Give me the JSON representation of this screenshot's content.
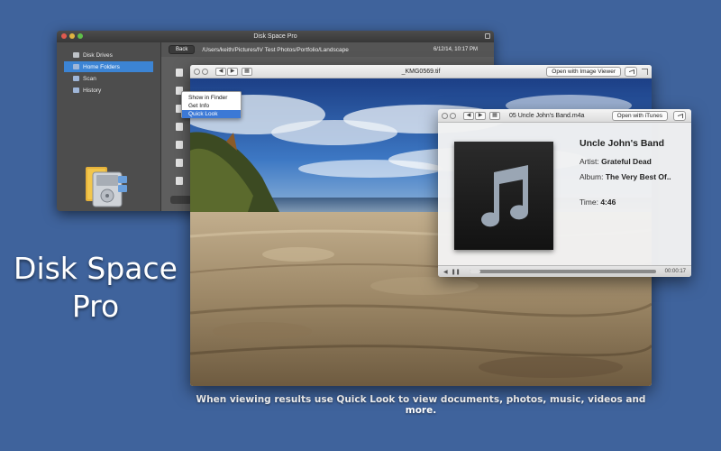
{
  "main_window": {
    "title": "Disk Space Pro",
    "sidebar": {
      "items": [
        {
          "label": "Disk Drives",
          "icon": "disk-icon",
          "active": false
        },
        {
          "label": "Home Folders",
          "icon": "folder-icon",
          "active": true
        },
        {
          "label": "Scan",
          "icon": "folder-icon",
          "active": false
        },
        {
          "label": "History",
          "icon": "folder-icon",
          "active": false
        }
      ]
    },
    "toolbar": {
      "back_label": "Back",
      "path": "/Users/keith/Pictures/IV Test Photos/Portfolio/Landscape",
      "date": "6/12/14, 10:17 PM"
    }
  },
  "context_menu": {
    "items": [
      {
        "label": "Show in Finder",
        "highlighted": false
      },
      {
        "label": "Get Info",
        "highlighted": false
      },
      {
        "label": "Quick Look",
        "highlighted": true
      }
    ]
  },
  "image_quicklook": {
    "filename": "_KMG0569.tif",
    "open_button": "Open with Image Viewer"
  },
  "music_quicklook": {
    "filename": "05 Uncle John's Band.m4a",
    "open_button": "Open with iTunes",
    "song_title": "Uncle John's Band",
    "artist_label": "Artist:",
    "artist": "Grateful Dead",
    "album_label": "Album:",
    "album": "The Very Best Of..",
    "time_label": "Time:",
    "time": "4:46",
    "elapsed": "00:00:17",
    "progress": 0.06
  },
  "promo": {
    "brand_line1": "Disk Space",
    "brand_line2": "Pro",
    "caption": "When viewing results use Quick Look to view documents, photos, music, videos and more."
  },
  "colors": {
    "background": "#3f639c",
    "selection": "#3c84d4",
    "menu_highlight": "#3c79d6"
  }
}
